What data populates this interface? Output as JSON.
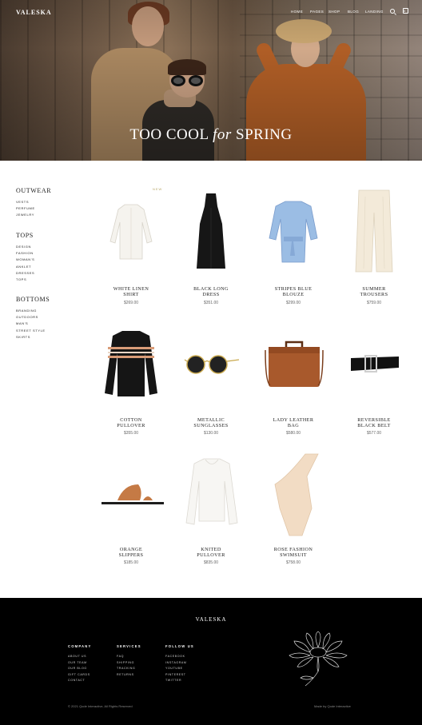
{
  "header": {
    "logo": "VALESKA",
    "nav": [
      {
        "label": "HOME"
      },
      {
        "label": "PAGES"
      },
      {
        "label": "SHOP"
      },
      {
        "label": "BLOG"
      },
      {
        "label": "LANDING"
      }
    ],
    "cart_count": "0"
  },
  "hero": {
    "title_part1": "TOO COOL ",
    "title_italic": "for",
    "title_part2": " SPRING"
  },
  "sidebar": {
    "groups": [
      {
        "title": "OUTWEAR",
        "items": [
          "VESTS",
          "PERFUME",
          "JEWELRY"
        ]
      },
      {
        "title": "TOPS",
        "items": [
          "DESIGN",
          "FASHION",
          "WOMAN'S",
          "ANKLET",
          "DRESSES",
          "TOPS"
        ]
      },
      {
        "title": "BOTTOMS",
        "items": [
          "BRANDING",
          "OUTDOORS",
          "MAN'S",
          "STREET STYLE",
          "SKIRTS"
        ]
      }
    ]
  },
  "badge_new": "NEW",
  "products": [
    {
      "name_line1": "WHITE LINEN",
      "name_line2": "SHIRT",
      "price": "$269.00"
    },
    {
      "name_line1": "BLACK LONG",
      "name_line2": "DRESS",
      "price": "$351.00"
    },
    {
      "name_line1": "STRIPES BLUE",
      "name_line2": "BLOUZE",
      "price": "$299.00"
    },
    {
      "name_line1": "SUMMER",
      "name_line2": "TROUSERS",
      "price": "$759.00"
    },
    {
      "name_line1": "COTTON",
      "name_line2": "PULLOVER",
      "price": "$355.00"
    },
    {
      "name_line1": "METALLIC",
      "name_line2": "SUNGLASSES",
      "price": "$130.00"
    },
    {
      "name_line1": "LADY LEATHER",
      "name_line2": "BAG",
      "price": "$580.00"
    },
    {
      "name_line1": "REVERSIBLE",
      "name_line2": "BLACK BELT",
      "price": "$577.00"
    },
    {
      "name_line1": "ORANGE",
      "name_line2": "SLIPPERS",
      "price": "$185.00"
    },
    {
      "name_line1": "KNITED",
      "name_line2": "PULLOVER",
      "price": "$835.00"
    },
    {
      "name_line1": "ROSE FASHION",
      "name_line2": "SWIMSUIT",
      "price": "$758.00"
    }
  ],
  "footer": {
    "logo": "VALESKA",
    "columns": [
      {
        "title": "COMPANY",
        "items": [
          "ABOUT US",
          "OUR TEAM",
          "OUR BLOG",
          "GIFT CARDS",
          "CONTACT"
        ]
      },
      {
        "title": "SERVICES",
        "items": [
          "FAQ",
          "SHIPPING",
          "TRACKING",
          "RETURNS"
        ]
      },
      {
        "title": "FOLLOW US",
        "items": [
          "FACEBOOK",
          "INSTAGRAM",
          "YOUTUBE",
          "PINTEREST",
          "TWITTER"
        ]
      }
    ],
    "copyright": "© 2021 Qode Interactive, All Rights Reserved",
    "made_by": "Made by Qode Interactive"
  },
  "colors": {
    "footer_bg": "#000000",
    "accent_new": "#b8a76a",
    "text": "#222222"
  }
}
